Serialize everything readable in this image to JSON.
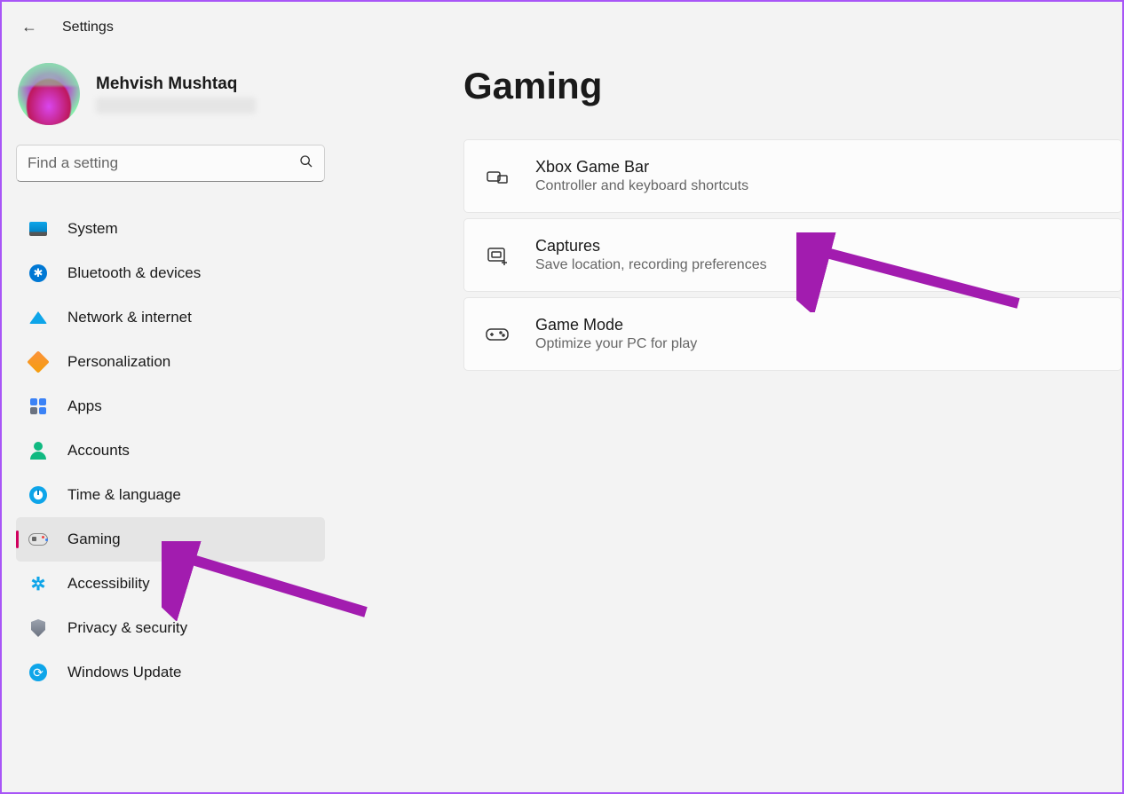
{
  "header": {
    "title": "Settings"
  },
  "user": {
    "name": "Mehvish Mushtaq"
  },
  "search": {
    "placeholder": "Find a setting"
  },
  "sidebar": {
    "items": [
      {
        "id": "system",
        "label": "System"
      },
      {
        "id": "bluetooth",
        "label": "Bluetooth & devices"
      },
      {
        "id": "network",
        "label": "Network & internet"
      },
      {
        "id": "personalization",
        "label": "Personalization"
      },
      {
        "id": "apps",
        "label": "Apps"
      },
      {
        "id": "accounts",
        "label": "Accounts"
      },
      {
        "id": "time",
        "label": "Time & language"
      },
      {
        "id": "gaming",
        "label": "Gaming"
      },
      {
        "id": "accessibility",
        "label": "Accessibility"
      },
      {
        "id": "privacy",
        "label": "Privacy & security"
      },
      {
        "id": "update",
        "label": "Windows Update"
      }
    ]
  },
  "main": {
    "title": "Gaming",
    "cards": [
      {
        "id": "xbox",
        "title": "Xbox Game Bar",
        "sub": "Controller and keyboard shortcuts"
      },
      {
        "id": "captures",
        "title": "Captures",
        "sub": "Save location, recording preferences"
      },
      {
        "id": "gamemode",
        "title": "Game Mode",
        "sub": "Optimize your PC for play"
      }
    ]
  }
}
